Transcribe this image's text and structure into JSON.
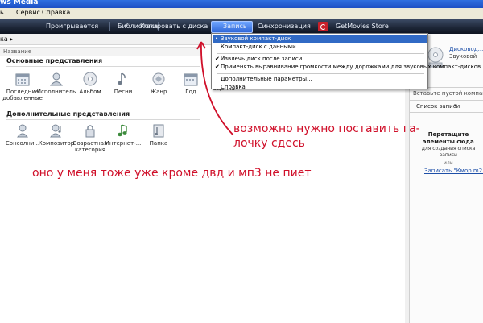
{
  "window": {
    "title": "ws Media"
  },
  "menu": {
    "items": [
      "ь",
      "Сервис",
      "Справка"
    ]
  },
  "nav": {
    "tabs": [
      "Проигрывается",
      "Библиотека",
      "Копировать с диска",
      "Запись",
      "Синхронизация"
    ],
    "store": "GetMovies Store"
  },
  "address": {
    "text": "ка ▸"
  },
  "list": {
    "column": "Название"
  },
  "sections": {
    "primary": "Основные представления",
    "additional": "Дополнительные представления"
  },
  "primary_tiles": [
    {
      "label": "Последние добавленные",
      "icon": "calendar-icon"
    },
    {
      "label": "Исполнитель",
      "icon": "artist-icon"
    },
    {
      "label": "Альбом",
      "icon": "disc-icon"
    },
    {
      "label": "Песни",
      "icon": "music-note-icon"
    },
    {
      "label": "Жанр",
      "icon": "genre-icon"
    },
    {
      "label": "Год",
      "icon": "calendar-icon"
    },
    {
      "label": "Оценка",
      "icon": "rating-icon"
    }
  ],
  "additional_tiles": [
    {
      "label": "Сонсолни...",
      "icon": "microphone-icon"
    },
    {
      "label": "Композитор",
      "icon": "composer-icon"
    },
    {
      "label": "Возрастная категория",
      "icon": "lock-icon"
    },
    {
      "label": "Интернет-...",
      "icon": "internet-music-icon"
    },
    {
      "label": "Папка",
      "icon": "folder-icon"
    }
  ],
  "dropdown": {
    "items": [
      {
        "label": "Звуковой компакт-диск",
        "mark": "•",
        "selected": true
      },
      {
        "label": "Компакт-диск с данными",
        "mark": "",
        "selected": false
      },
      {
        "label": "Извлечь диск после записи",
        "mark": "✔",
        "selected": false
      },
      {
        "label": "Применять выравнивание громкости между дорожками для звуковых компакт-дисков",
        "mark": "✔",
        "selected": false
      },
      {
        "label": "Дополнительные параметры...",
        "mark": "",
        "selected": false
      },
      {
        "label": "Справка",
        "mark": "",
        "selected": false
      }
    ]
  },
  "right_panel": {
    "disc_title": "Дисковод...",
    "disc_sub": "Звуковой",
    "insert": "Вставьте пустой компакт-дис",
    "list_label": "Список записи",
    "drag_title": "Перетащите элементы сюда",
    "drag_sub": "для создания списка записи",
    "or": "или",
    "burn_link": "Записать \"Кмор m2 4\"."
  },
  "annotations": {
    "line1": "возможно нужно поставить га-",
    "line2": "лочку сдесь",
    "line3": "оно у меня тоже уже кроме двд и мп3 не пиет"
  },
  "colors": {
    "accent": "#316ac5",
    "annotation": "#d0102a",
    "nav_bg": "#1c2536"
  }
}
